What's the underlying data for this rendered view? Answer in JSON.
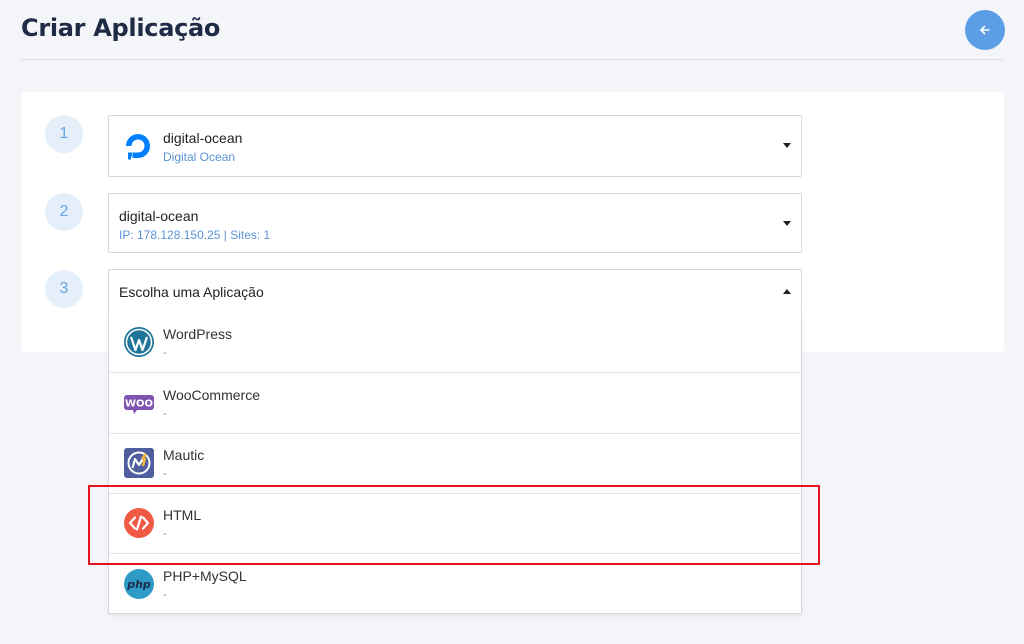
{
  "header": {
    "title": "Criar Aplicação",
    "back_icon": "arrow-left-icon"
  },
  "steps": [
    {
      "number": "1"
    },
    {
      "number": "2"
    },
    {
      "number": "3"
    }
  ],
  "provider_select": {
    "value": "digital-ocean",
    "subtitle": "Digital Ocean",
    "icon": "digital-ocean-icon"
  },
  "server_select": {
    "value": "digital-ocean",
    "subtitle": "IP: 178.128.150.25 | Sites: 1"
  },
  "app_select": {
    "placeholder": "Escolha uma Aplicação",
    "expanded": true
  },
  "app_options": [
    {
      "name": "WordPress",
      "desc": "-",
      "icon": "wordpress-icon"
    },
    {
      "name": "WooCommerce",
      "desc": "-",
      "icon": "woocommerce-icon"
    },
    {
      "name": "Mautic",
      "desc": "-",
      "icon": "mautic-icon"
    },
    {
      "name": "HTML",
      "desc": "-",
      "icon": "html-code-icon",
      "highlighted": true
    },
    {
      "name": "PHP+MySQL",
      "desc": "-",
      "icon": "php-icon"
    }
  ],
  "colors": {
    "accent": "#5b9ee6",
    "highlight": "#e3131e",
    "subtitle_blue": "#5a93d8"
  }
}
